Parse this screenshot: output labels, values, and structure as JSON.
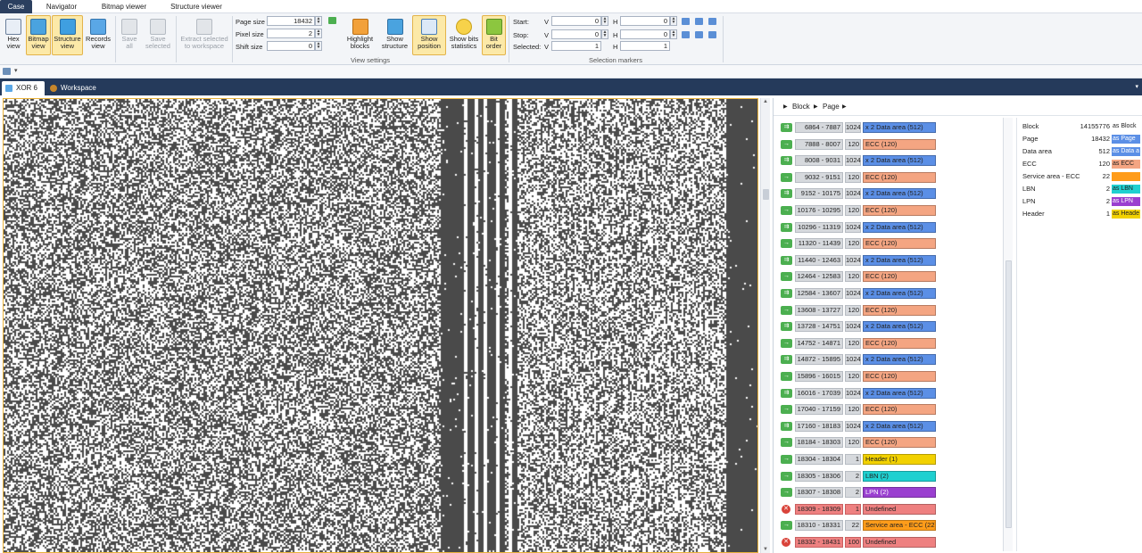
{
  "menu_tabs": [
    {
      "label": "Case",
      "active": true
    },
    {
      "label": "Navigator",
      "active": false
    },
    {
      "label": "Bitmap viewer",
      "active": false
    },
    {
      "label": "Structure viewer",
      "active": false
    }
  ],
  "ribbon": {
    "buttons": [
      {
        "label1": "Hex",
        "label2": "view",
        "icon": "hex-view-icon",
        "active": false,
        "disabled": false
      },
      {
        "label1": "Bitmap",
        "label2": "view",
        "icon": "bitmap-view-icon",
        "active": true,
        "disabled": false
      },
      {
        "label1": "Structure",
        "label2": "view",
        "icon": "structure-view-icon",
        "active": true,
        "disabled": false
      },
      {
        "label1": "Records",
        "label2": "view",
        "icon": "records-view-icon",
        "active": false,
        "disabled": false
      },
      {
        "label1": "Save",
        "label2": "all",
        "icon": "save-all-icon",
        "active": false,
        "disabled": true
      },
      {
        "label1": "Save",
        "label2": "selected",
        "icon": "save-selected-icon",
        "active": false,
        "disabled": true
      },
      {
        "label1": "Extract selected",
        "label2": "to workspace",
        "icon": "extract-icon",
        "active": false,
        "disabled": true
      }
    ],
    "view_settings": {
      "page_size_label": "Page size",
      "page_size": "18432",
      "pixel_size_label": "Pixel size",
      "pixel_size": "2",
      "shift_size_label": "Shift size",
      "shift_size": "0",
      "buttons": [
        {
          "label1": "Highlight",
          "label2": "blocks",
          "icon": "highlight-blocks-icon",
          "active": false
        },
        {
          "label1": "Show",
          "label2": "structure",
          "icon": "show-structure-icon",
          "active": false
        },
        {
          "label1": "Show",
          "label2": "position",
          "icon": "show-position-icon",
          "active": true
        },
        {
          "label1": "Show bits",
          "label2": "statistics",
          "icon": "bulb-icon",
          "active": false
        },
        {
          "label1": "Bit",
          "label2": "order",
          "icon": "bit-order-icon",
          "active": true
        }
      ],
      "group_label": "View settings"
    },
    "selection_markers": {
      "start_label": "Start:",
      "stop_label": "Stop:",
      "selected_label": "Selected:",
      "v_label": "V",
      "h_label": "H",
      "start_v": "0",
      "start_h": "0",
      "stop_v": "0",
      "stop_h": "0",
      "selected_v": "1",
      "selected_h": "1",
      "group_label": "Selection markers"
    }
  },
  "doc_tabs": [
    {
      "label": "XOR 6",
      "active": true,
      "close": "✕"
    },
    {
      "label": "Workspace",
      "active": false,
      "close": ""
    }
  ],
  "structure": {
    "breadcrumb": [
      "Block",
      "Page"
    ],
    "rows": [
      {
        "range": "6864 - 7887",
        "size": "1024",
        "label": "x 2 Data area (512)",
        "kind": "data",
        "status": "double"
      },
      {
        "range": "7888 - 8007",
        "size": "120",
        "label": "ECC (120)",
        "kind": "ecc",
        "status": "single"
      },
      {
        "range": "8008 - 9031",
        "size": "1024",
        "label": "x 2 Data area (512)",
        "kind": "data",
        "status": "double"
      },
      {
        "range": "9032 - 9151",
        "size": "120",
        "label": "ECC (120)",
        "kind": "ecc",
        "status": "single"
      },
      {
        "range": "9152 - 10175",
        "size": "1024",
        "label": "x 2 Data area (512)",
        "kind": "data",
        "status": "double"
      },
      {
        "range": "10176 - 10295",
        "size": "120",
        "label": "ECC (120)",
        "kind": "ecc",
        "status": "single"
      },
      {
        "range": "10296 - 11319",
        "size": "1024",
        "label": "x 2 Data area (512)",
        "kind": "data",
        "status": "double"
      },
      {
        "range": "11320 - 11439",
        "size": "120",
        "label": "ECC (120)",
        "kind": "ecc",
        "status": "single"
      },
      {
        "range": "11440 - 12463",
        "size": "1024",
        "label": "x 2 Data area (512)",
        "kind": "data",
        "status": "double"
      },
      {
        "range": "12464 - 12583",
        "size": "120",
        "label": "ECC (120)",
        "kind": "ecc",
        "status": "single"
      },
      {
        "range": "12584 - 13607",
        "size": "1024",
        "label": "x 2 Data area (512)",
        "kind": "data",
        "status": "double"
      },
      {
        "range": "13608 - 13727",
        "size": "120",
        "label": "ECC (120)",
        "kind": "ecc",
        "status": "single"
      },
      {
        "range": "13728 - 14751",
        "size": "1024",
        "label": "x 2 Data area (512)",
        "kind": "data",
        "status": "double"
      },
      {
        "range": "14752 - 14871",
        "size": "120",
        "label": "ECC (120)",
        "kind": "ecc",
        "status": "single"
      },
      {
        "range": "14872 - 15895",
        "size": "1024",
        "label": "x 2 Data area (512)",
        "kind": "data",
        "status": "double"
      },
      {
        "range": "15896 - 16015",
        "size": "120",
        "label": "ECC (120)",
        "kind": "ecc",
        "status": "single"
      },
      {
        "range": "16016 - 17039",
        "size": "1024",
        "label": "x 2 Data area (512)",
        "kind": "data",
        "status": "double"
      },
      {
        "range": "17040 - 17159",
        "size": "120",
        "label": "ECC (120)",
        "kind": "ecc",
        "status": "single"
      },
      {
        "range": "17160 - 18183",
        "size": "1024",
        "label": "x 2 Data area (512)",
        "kind": "data",
        "status": "double"
      },
      {
        "range": "18184 - 18303",
        "size": "120",
        "label": "ECC (120)",
        "kind": "ecc",
        "status": "single"
      },
      {
        "range": "18304 - 18304",
        "size": "1",
        "label": "Header (1)",
        "kind": "header",
        "status": "single"
      },
      {
        "range": "18305 - 18306",
        "size": "2",
        "label": "LBN (2)",
        "kind": "lbn",
        "status": "single"
      },
      {
        "range": "18307 - 18308",
        "size": "2",
        "label": "LPN (2)",
        "kind": "lpn",
        "status": "single"
      },
      {
        "range": "18309 - 18309",
        "size": "1",
        "label": "Undefined",
        "kind": "undefined",
        "status": "error"
      },
      {
        "range": "18310 - 18331",
        "size": "22",
        "label": "Service area - ECC (22)",
        "kind": "service",
        "status": "single"
      },
      {
        "range": "18332 - 18431",
        "size": "100",
        "label": "Undefined",
        "kind": "undefined",
        "status": "error"
      }
    ],
    "properties": [
      {
        "name": "Block",
        "value": "14155776",
        "as": "as Block",
        "kind": "none"
      },
      {
        "name": "Page",
        "value": "18432",
        "as": "as Page",
        "kind": "data"
      },
      {
        "name": "Data area",
        "value": "512",
        "as": "as Data a",
        "kind": "data"
      },
      {
        "name": "ECC",
        "value": "120",
        "as": "as ECC",
        "kind": "ecc"
      },
      {
        "name": "Service area - ECC",
        "value": "22",
        "as": "",
        "kind": "service"
      },
      {
        "name": "LBN",
        "value": "2",
        "as": "as LBN",
        "kind": "lbn"
      },
      {
        "name": "LPN",
        "value": "2",
        "as": "as LPN",
        "kind": "lpn"
      },
      {
        "name": "Header",
        "value": "1",
        "as": "as Heade",
        "kind": "header"
      }
    ]
  },
  "colors": {
    "data": "#5b8fe6",
    "ecc": "#f4a582",
    "header": "#f2d100",
    "lbn": "#1fd0d0",
    "lpn": "#9a3fd0",
    "undefined": "#ee8080",
    "service": "#ff9c1a",
    "arrow_green": "#4caf50",
    "error_red": "#d9433a",
    "accent": "#e9b23c",
    "tab_dark": "#253a5b"
  }
}
